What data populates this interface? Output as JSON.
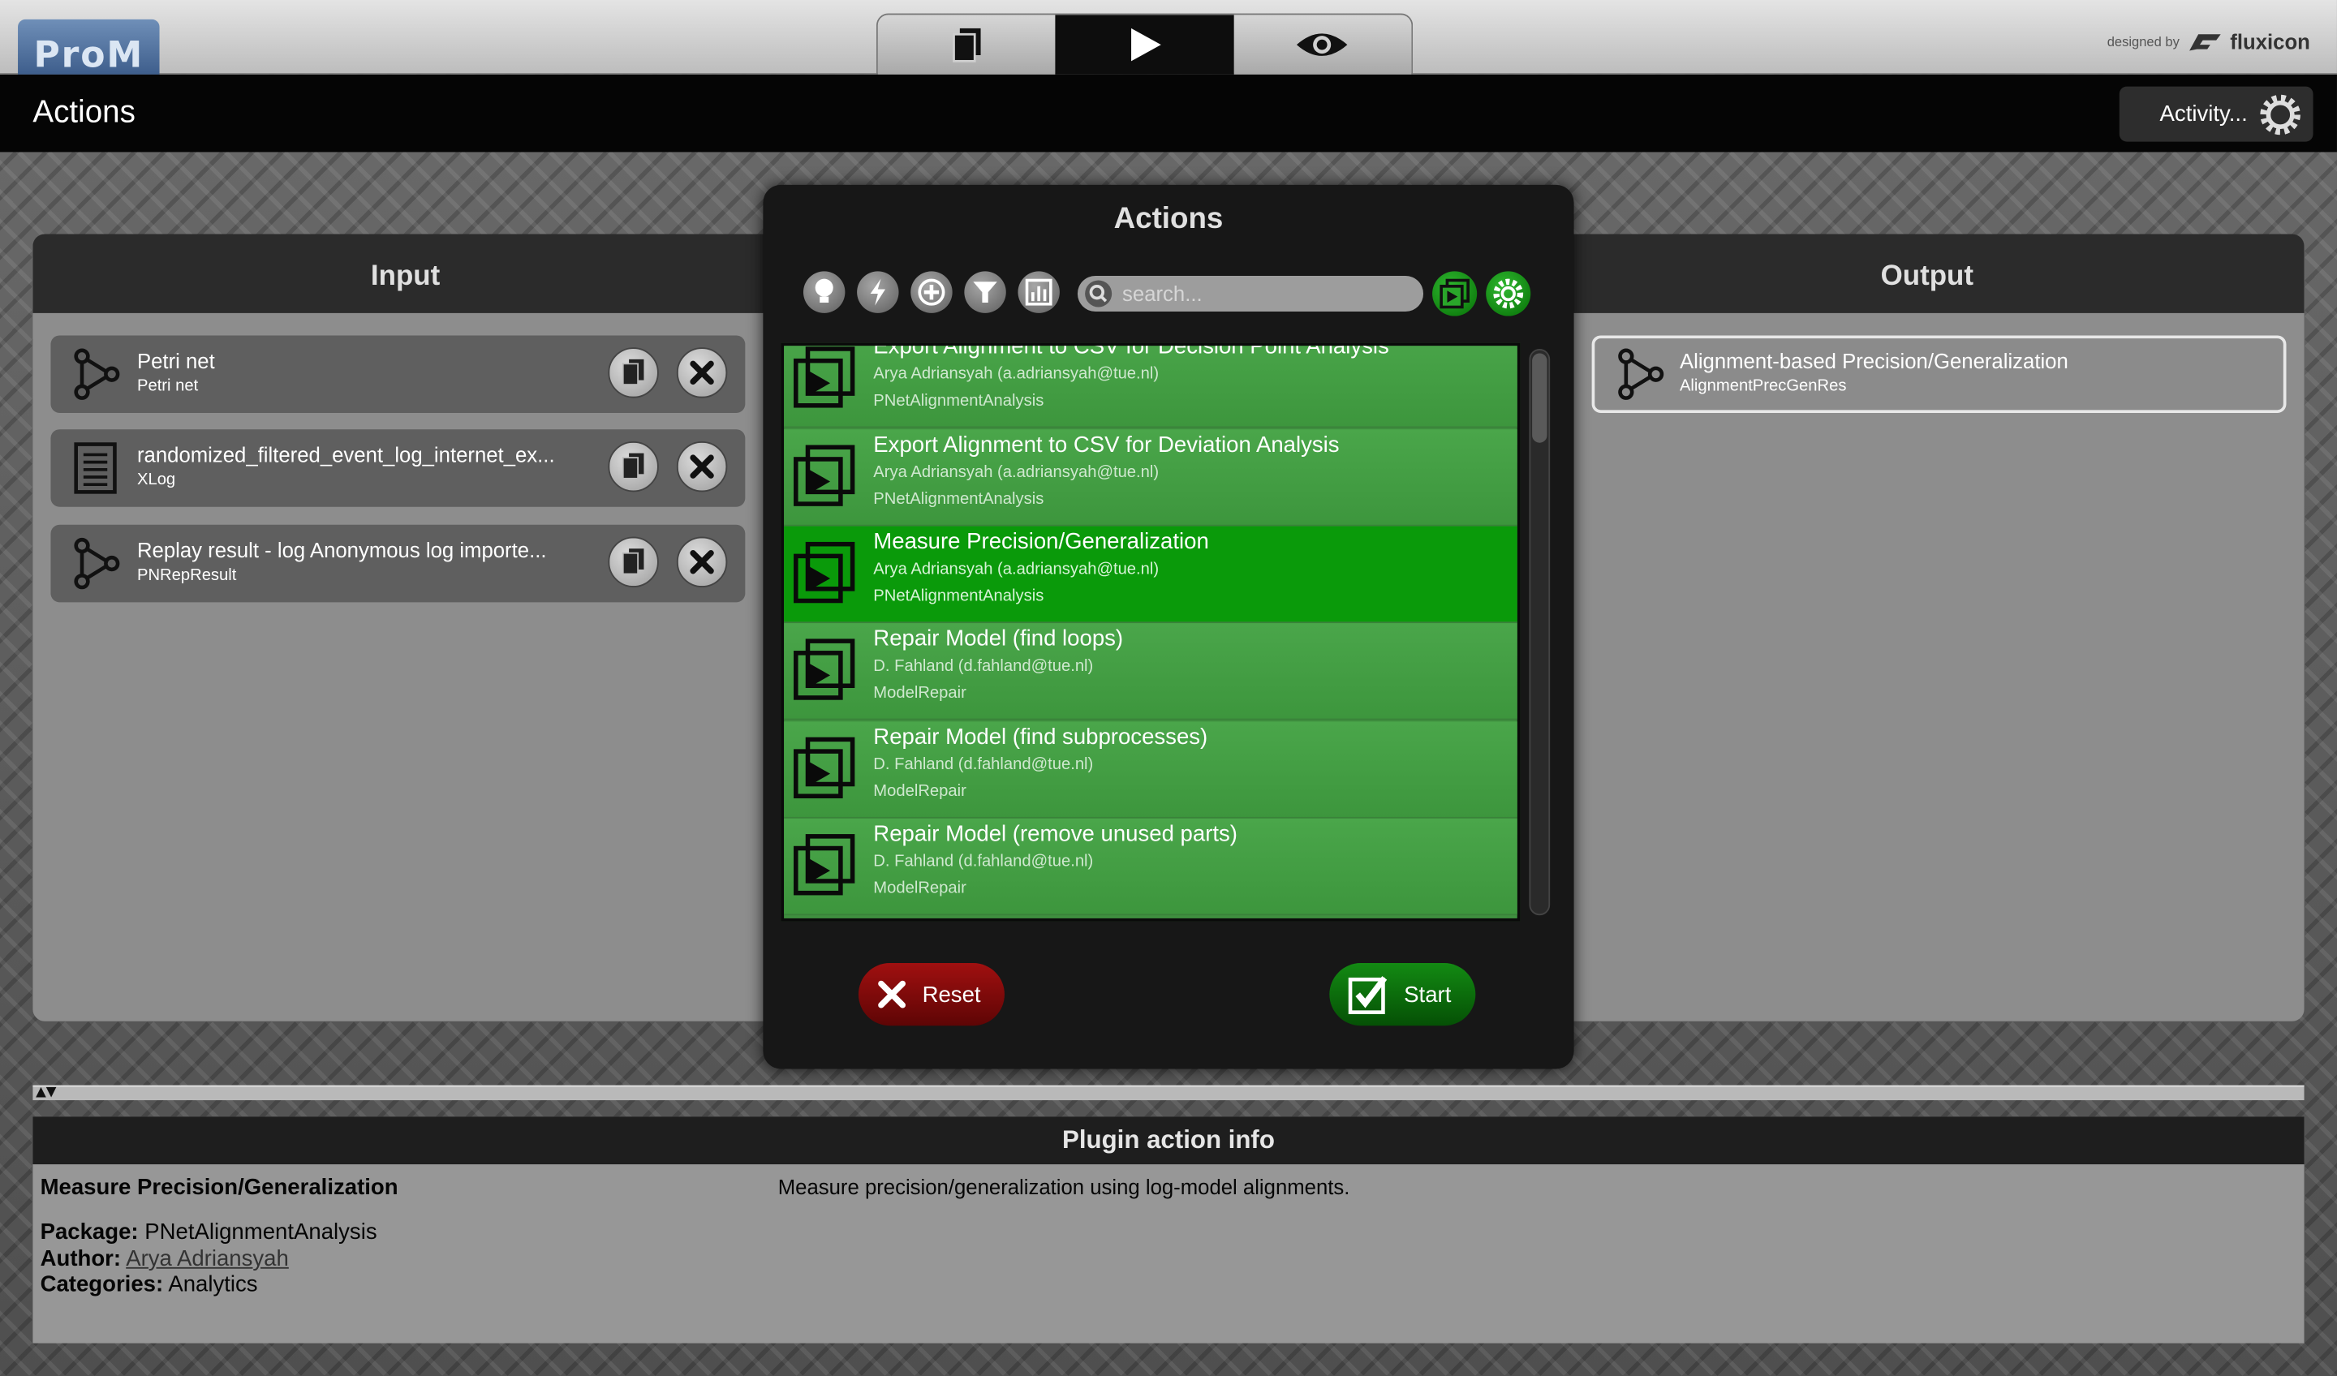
{
  "app": {
    "logo": "ProM",
    "designed_by": "designed by",
    "brand": "fluxicon",
    "mode_tabs": [
      {
        "icon": "workspace-icon"
      },
      {
        "icon": "play-icon",
        "active": true
      },
      {
        "icon": "eye-icon"
      }
    ]
  },
  "header": {
    "title": "Actions",
    "activity_label": "Activity..."
  },
  "input": {
    "heading": "Input",
    "items": [
      {
        "name": "Petri net",
        "type": "Petri net",
        "icon": "petri-net-icon"
      },
      {
        "name": "randomized_filtered_event_log_internet_ex...",
        "type": "XLog",
        "icon": "document-icon"
      },
      {
        "name": "Replay result - log Anonymous log importe...",
        "type": "PNRepResult",
        "icon": "petri-net-icon"
      }
    ]
  },
  "output": {
    "heading": "Output",
    "items": [
      {
        "name": "Alignment-based Precision/Generalization",
        "type": "AlignmentPrecGenRes",
        "icon": "petri-net-icon"
      }
    ]
  },
  "dialog": {
    "title": "Actions",
    "search_placeholder": "search...",
    "toolbar_icons": [
      "lightbulb-icon",
      "lightning-icon",
      "plus-circle-icon",
      "filter-icon",
      "chart-icon"
    ],
    "actions": [
      {
        "name": "Export Alignment to CSV for Decision Point Analysis",
        "author": "Arya Adriansyah (a.adriansyah@tue.nl)",
        "package": "PNetAlignmentAnalysis",
        "selected": false
      },
      {
        "name": "Export Alignment to CSV for Deviation Analysis",
        "author": "Arya Adriansyah (a.adriansyah@tue.nl)",
        "package": "PNetAlignmentAnalysis",
        "selected": false
      },
      {
        "name": "Measure Precision/Generalization",
        "author": "Arya Adriansyah (a.adriansyah@tue.nl)",
        "package": "PNetAlignmentAnalysis",
        "selected": true
      },
      {
        "name": "Repair Model (find loops)",
        "author": "D. Fahland (d.fahland@tue.nl)",
        "package": "ModelRepair",
        "selected": false
      },
      {
        "name": "Repair Model (find subprocesses)",
        "author": "D. Fahland (d.fahland@tue.nl)",
        "package": "ModelRepair",
        "selected": false
      },
      {
        "name": "Repair Model (remove unused parts)",
        "author": "D. Fahland (d.fahland@tue.nl)",
        "package": "ModelRepair",
        "selected": false
      }
    ],
    "reset_label": "Reset",
    "start_label": "Start"
  },
  "info": {
    "heading": "Plugin action info",
    "plugin_name": "Measure Precision/Generalization",
    "description": "Measure precision/generalization using log-model alignments.",
    "package_label": "Package:",
    "package": "PNetAlignmentAnalysis",
    "author_label": "Author:",
    "author": "Arya Adriansyah",
    "categories_label": "Categories:",
    "categories": "Analytics"
  },
  "colors": {
    "accent_green": "#0a9a0a",
    "list_green": "#4aa64a",
    "reset_red": "#a01010"
  }
}
